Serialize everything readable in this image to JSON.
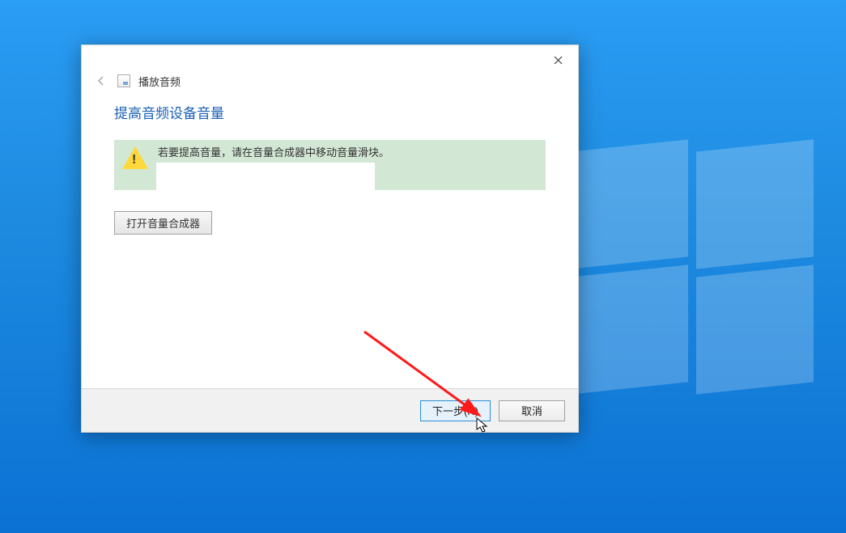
{
  "header": {
    "breadcrumb_title": "播放音频"
  },
  "main": {
    "heading": "提高音频设备音量",
    "notice": "若要提高音量，请在音量合成器中移动音量滑块。",
    "open_mixer_button": "打开音量合成器"
  },
  "footer": {
    "next": "下一步(N)",
    "cancel": "取消"
  },
  "colors": {
    "accent": "#1a5fb4",
    "notice_bg": "#d3e7d5",
    "annotation": "#ff1a1a"
  }
}
